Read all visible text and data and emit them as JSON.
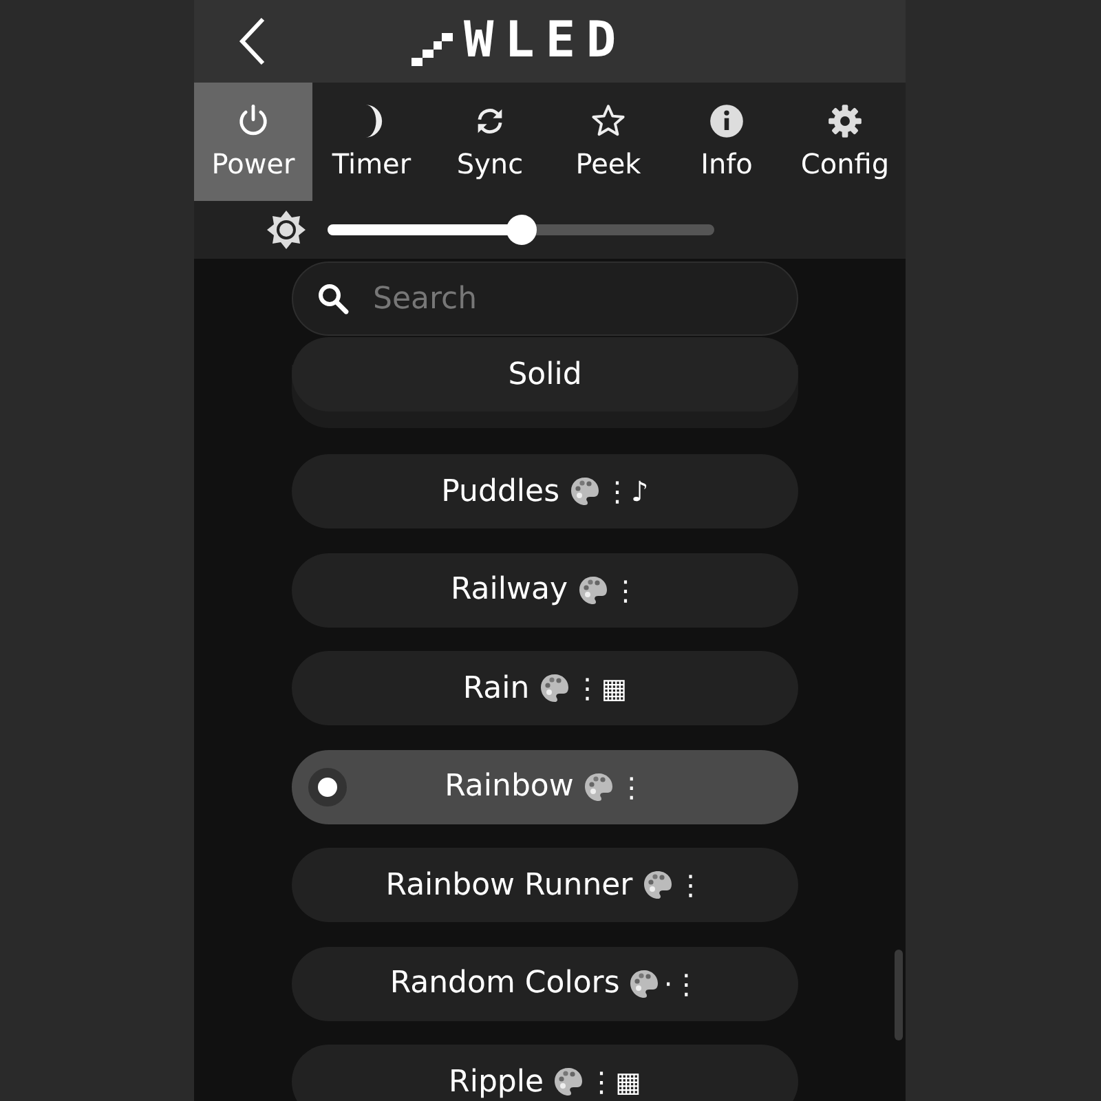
{
  "header": {
    "logo": "WLED"
  },
  "tabs": [
    {
      "label": "Power",
      "kind": "power",
      "selected": true
    },
    {
      "label": "Timer",
      "kind": "moon",
      "selected": false
    },
    {
      "label": "Sync",
      "kind": "sync",
      "selected": false
    },
    {
      "label": "Peek",
      "kind": "star",
      "selected": false
    },
    {
      "label": "Info",
      "kind": "info",
      "selected": false
    },
    {
      "label": "Config",
      "kind": "gear",
      "selected": false
    }
  ],
  "brightness": {
    "level": 0.5
  },
  "search": {
    "placeholder": "Search"
  },
  "sticky_effect": {
    "name": "Solid"
  },
  "effects": [
    {
      "name": "Puddles",
      "palette": true,
      "symbols": "⋮♪",
      "selected": false
    },
    {
      "name": "Railway",
      "palette": true,
      "symbols": "⋮",
      "selected": false
    },
    {
      "name": "Rain",
      "palette": true,
      "symbols": "⋮▦",
      "selected": false
    },
    {
      "name": "Rainbow",
      "palette": true,
      "symbols": "⋮",
      "selected": true
    },
    {
      "name": "Rainbow Runner",
      "palette": true,
      "symbols": "⋮",
      "selected": false
    },
    {
      "name": "Random Colors",
      "palette": true,
      "symbols": "·⋮",
      "selected": false
    },
    {
      "name": "Ripple",
      "palette": true,
      "symbols": "⋮▦",
      "selected": false
    }
  ]
}
